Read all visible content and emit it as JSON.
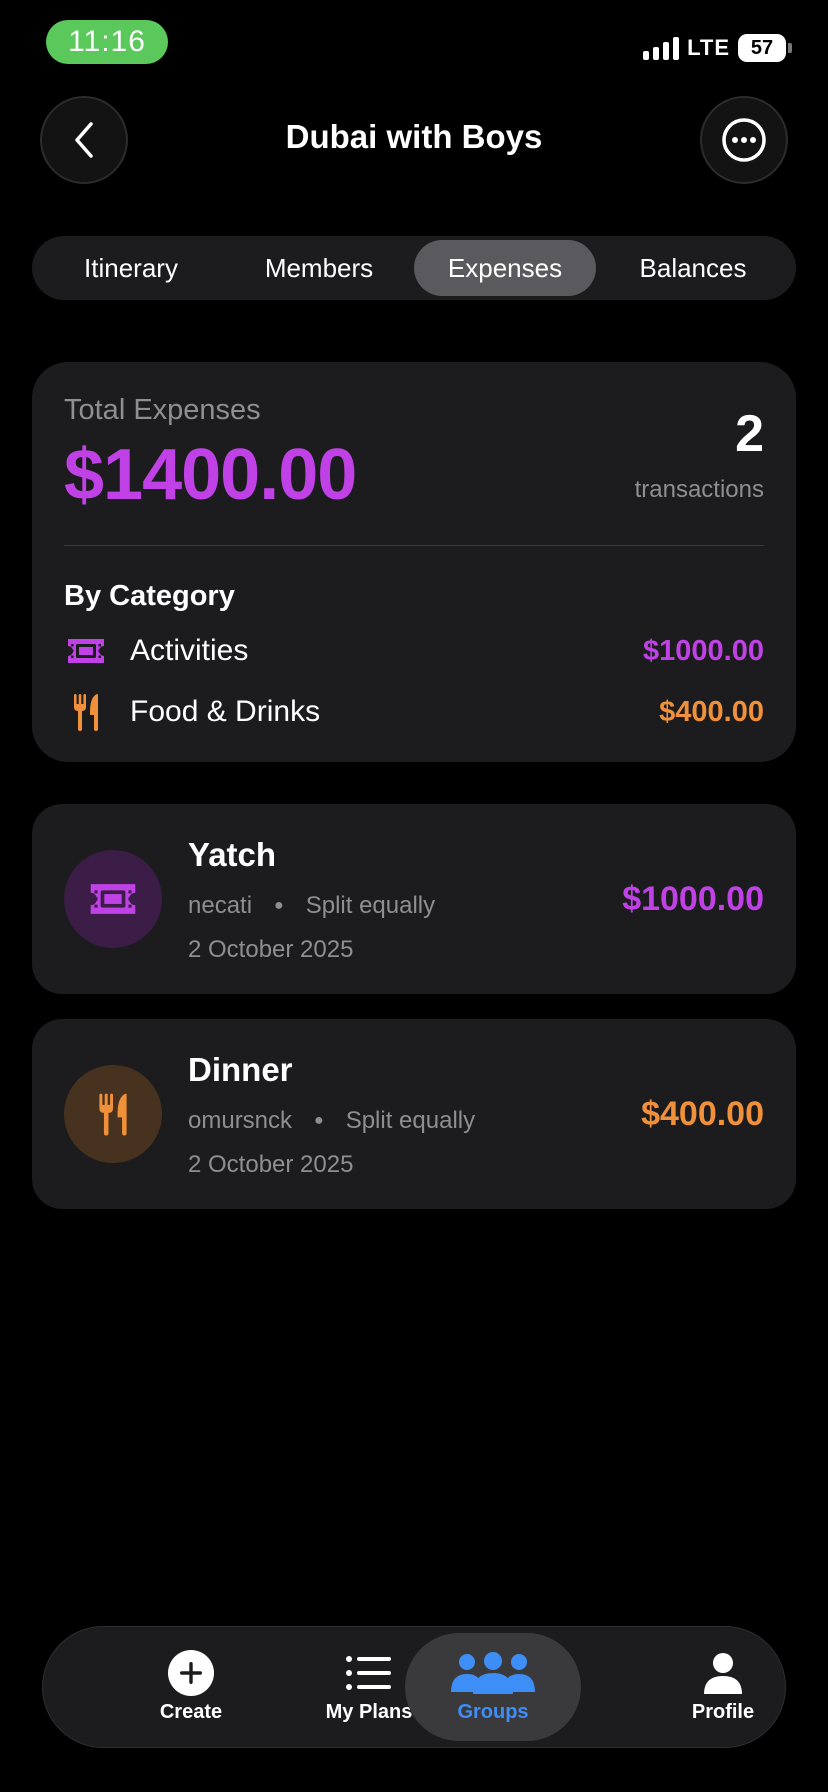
{
  "status_bar": {
    "time": "11:16",
    "network": "LTE",
    "battery": "57"
  },
  "header": {
    "title": "Dubai with Boys",
    "back_icon": "chevron-left-icon",
    "more_icon": "ellipsis-circle-icon"
  },
  "tabs": [
    {
      "label": "Itinerary",
      "active": false
    },
    {
      "label": "Members",
      "active": false
    },
    {
      "label": "Expenses",
      "active": true
    },
    {
      "label": "Balances",
      "active": false
    }
  ],
  "summary": {
    "total_label": "Total Expenses",
    "total_amount": "$1400.00",
    "transaction_count": "2",
    "transaction_label": "transactions",
    "by_category_title": "By Category",
    "categories": [
      {
        "name": "Activities",
        "amount": "$1000.00",
        "icon": "ticket-icon",
        "color": "#c042e6"
      },
      {
        "name": "Food & Drinks",
        "amount": "$400.00",
        "icon": "fork-knife-icon",
        "color": "#f0903a"
      }
    ]
  },
  "expenses": [
    {
      "title": "Yatch",
      "payer": "necati",
      "split": "Split equally",
      "date": "2 October 2025",
      "amount": "$1000.00",
      "icon": "ticket-icon",
      "color": "#c042e6",
      "icon_bg": "#3b1d47"
    },
    {
      "title": "Dinner",
      "payer": "omursnck",
      "split": "Split equally",
      "date": "2 October 2025",
      "amount": "$400.00",
      "icon": "fork-knife-icon",
      "color": "#f0903a",
      "icon_bg": "#47321f"
    }
  ],
  "bottom_nav": [
    {
      "label": "Create",
      "icon": "plus-circle-icon",
      "active": false
    },
    {
      "label": "My Plans",
      "icon": "list-icon",
      "active": false
    },
    {
      "label": "Groups",
      "icon": "people-icon",
      "active": true
    },
    {
      "label": "Profile",
      "icon": "person-icon",
      "active": false
    }
  ],
  "colors": {
    "accent_purple": "#c042e6",
    "accent_orange": "#f0903a",
    "accent_blue": "#3e8ef7"
  }
}
